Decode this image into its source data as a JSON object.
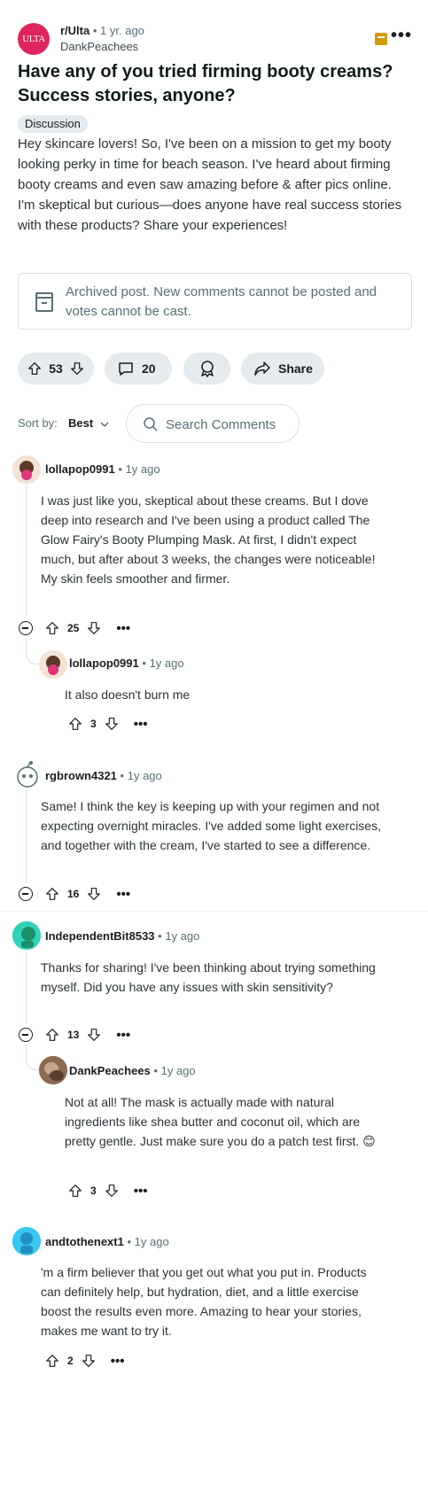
{
  "post": {
    "subreddit": "r/Ulta",
    "subreddit_logo_text": "ULTA",
    "age": "1 yr. ago",
    "author": "DankPeachees",
    "title": "Have any of you tried firming booty creams? Success stories, anyone?",
    "flair": "Discussion",
    "body": "Hey skincare lovers! So, I've been on a mission to get my booty looking perky in time for beach season. I've heard about firming booty creams and even saw amazing before & after pics online. I'm skeptical but curious—does anyone have real success stories with these products? Share your experiences!",
    "archived_notice": "Archived post. New comments cannot be posted and votes cannot be cast.",
    "score": "53",
    "comments_count": "20",
    "share_label": "Share"
  },
  "sort": {
    "label": "Sort by:",
    "value": "Best"
  },
  "search": {
    "placeholder": "Search Comments"
  },
  "comments": [
    {
      "author": "lollapop0991",
      "age": "1y ago",
      "body": "I was just like you, skeptical about these creams. But I dove deep into research and I've been using a product called The Glow Fairy's Booty Plumping Mask. At first, I didn't expect much, but after about 3 weeks, the changes were noticeable! My skin feels smoother and firmer.",
      "score": "25"
    },
    {
      "author": "lollapop0991",
      "age": "1y ago",
      "body": "It also doesn't burn me",
      "score": "3"
    },
    {
      "author": "rgbrown4321",
      "age": "1y ago",
      "body": "Same! I think the key is keeping up with your regimen and not expecting overnight miracles. I've added some light exercises, and together with the cream, I've started to see a difference.",
      "score": "16"
    },
    {
      "author": "IndependentBit8533",
      "age": "1y ago",
      "body": "Thanks for sharing! I've been thinking about trying something myself. Did you have any issues with skin sensitivity?",
      "score": "13"
    },
    {
      "author": "DankPeachees",
      "age": "1y ago",
      "body": "Not at all! The mask is actually made with natural ingredients like shea butter and coconut oil, which are pretty gentle. Just make sure you do a patch test first. 😊",
      "score": "3"
    },
    {
      "author": "andtothenext1",
      "age": "1y ago",
      "body": "'m a firm believer that you get out what you put in. Products can definitely help, but hydration, diet, and a little exercise boost the results even more. Amazing to hear your stories, makes me want to try it.",
      "score": "2"
    }
  ],
  "separator": "•",
  "ellipsis": "•••",
  "colors": {
    "pill_bg": "#e5ebee",
    "meta_text": "#576f76",
    "archive_badge": "#d19b00",
    "ulta_brand": "#e0245e"
  }
}
